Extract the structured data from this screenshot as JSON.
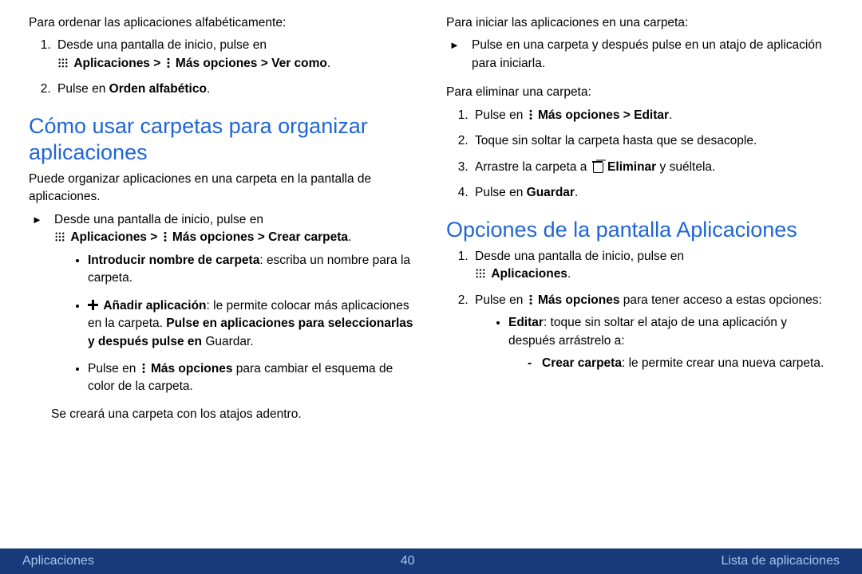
{
  "left": {
    "intro": "Para ordenar las aplicaciones alfabéticamente:",
    "step1": "Desde una pantalla de inicio, pulse en",
    "step1b": "Aplicaciones > ",
    "step1c": "Más opciones > Ver como",
    "step2a": "Pulse en ",
    "step2b": "Orden alfabético",
    "h2": "Cómo usar carpetas para organizar aplicaciones",
    "p2": "Puede organizar aplicaciones en una carpeta en la pantalla de aplicaciones.",
    "arrow": "Desde una pantalla de inicio, pulse en",
    "arrowb1": "Aplicaciones > ",
    "arrowb2": "Más opciones > Crear carpeta",
    "b1a": "Introducir nombre de carpeta",
    "b1b": ": escriba un nombre para la carpeta.",
    "b2a": "Añadir aplicación",
    "b2b": ": le permite colocar más aplicaciones en la carpeta. ",
    "b2c": "Pulse en aplicaciones para seleccionarlas y después pulse en ",
    "b2d": "Guardar.",
    "b3a": "Pulse en ",
    "b3b": "Más opciones",
    "b3c": " para cambiar el esquema de color de la carpeta.",
    "closing": "Se creará una carpeta con los atajos adentro."
  },
  "right": {
    "intro": "Para iniciar las aplicaciones en una carpeta:",
    "arrow1": "Pulse en una carpeta y después pulse en un atajo de aplicación para iniciarla.",
    "p2": "Para eliminar una carpeta:",
    "s1a": "Pulse en ",
    "s1b": "Más opciones > Editar",
    "s2": "Toque sin soltar la carpeta hasta que se desacople.",
    "s3a": "Arrastre la carpeta a ",
    "s3b": "Eliminar",
    "s3c": " y suéltela.",
    "s4a": "Pulse en ",
    "s4b": "Guardar",
    "h2": "Opciones de la pantalla Aplicaciones",
    "o1": "Desde una pantalla de inicio, pulse en",
    "o1b": "Aplicaciones",
    "o2a": "Pulse en ",
    "o2b": "Más opciones",
    "o2c": " para tener acceso a estas opciones:",
    "e1a": "Editar",
    "e1b": ": toque sin soltar el atajo de una aplicación y después arrástrelo a:",
    "d1a": "Crear carpeta",
    "d1b": ": le permite crear una nueva carpeta."
  },
  "footer": {
    "left": "Aplicaciones",
    "page": "40",
    "right": "Lista de aplicaciones"
  }
}
